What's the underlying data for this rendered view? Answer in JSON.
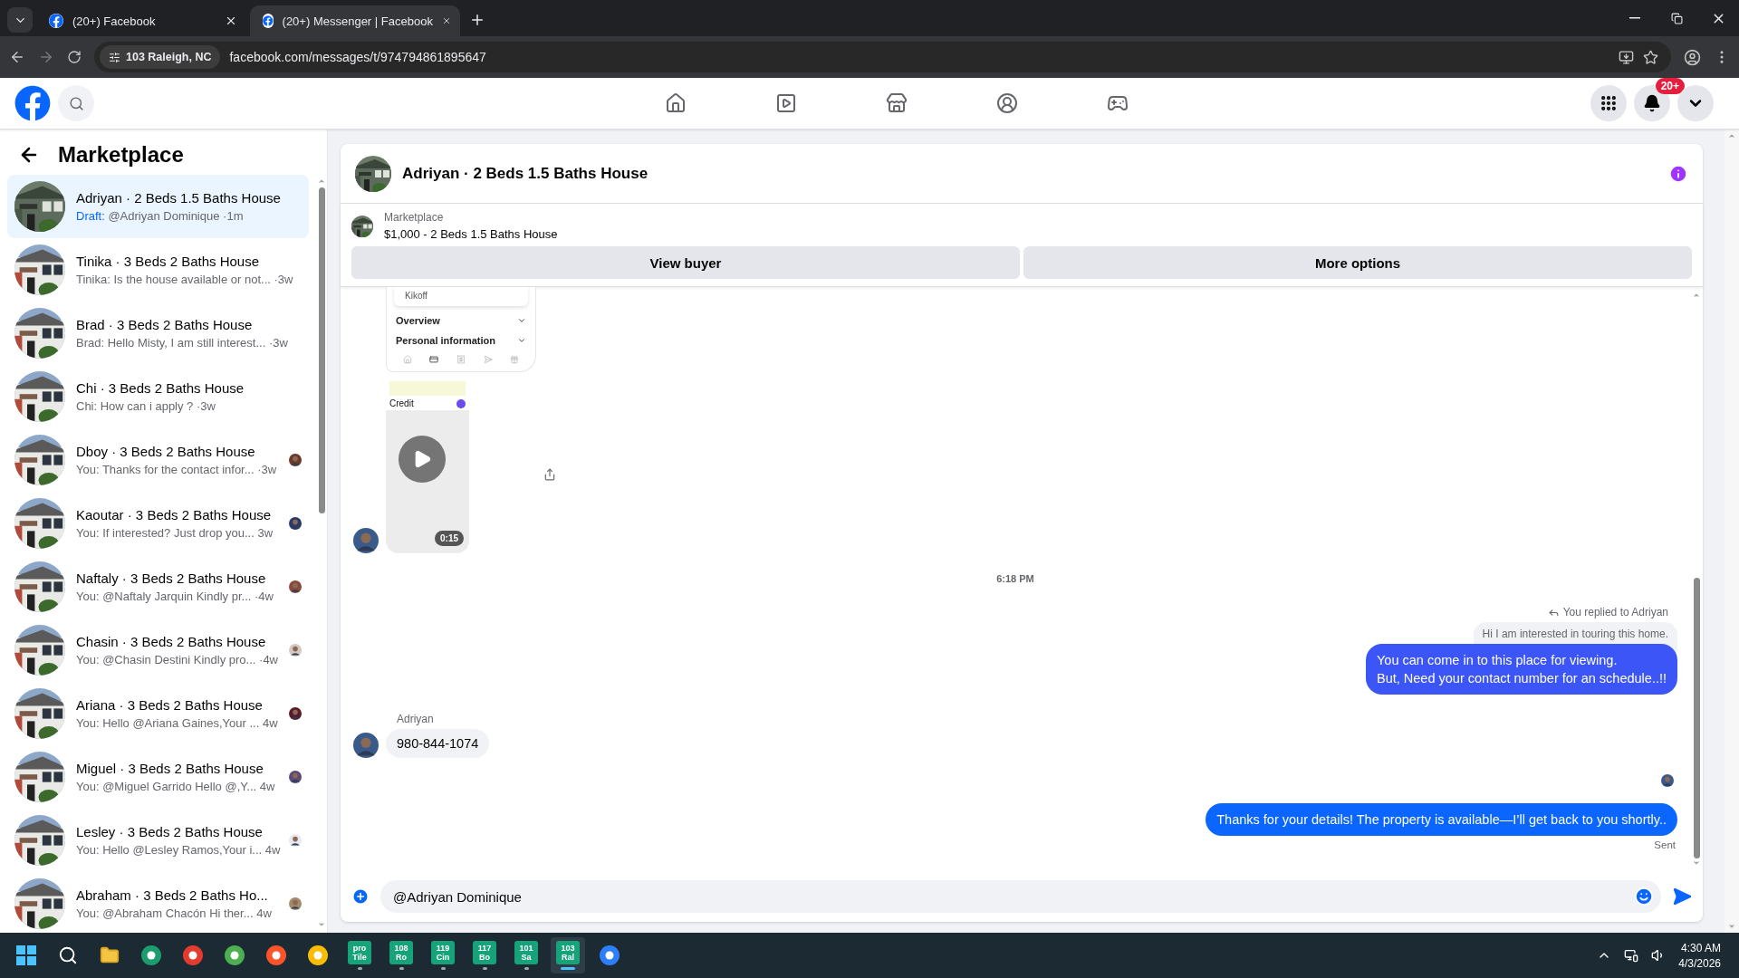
{
  "browser": {
    "tabs": [
      {
        "title": "(20+) Facebook",
        "selected": false
      },
      {
        "title": "(20+) Messenger | Facebook",
        "selected": true
      }
    ],
    "site_chip": "103 Raleigh, NC",
    "url": "facebook.com/messages/t/974794861895647"
  },
  "nav": {
    "notifications_badge": "20+"
  },
  "sidebar": {
    "title": "Marketplace",
    "conversations": [
      {
        "title": "Adriyan · 2 Beds 1.5 Baths House",
        "draft": "Draft:",
        "preview": "@Adriyan Dominique",
        "time": "·1m",
        "selected": true,
        "seen": false
      },
      {
        "title": "Tinika · 3 Beds 2 Baths House",
        "preview": "Tinika: Is the house available or not...",
        "time": "·3w",
        "selected": false,
        "seen": false
      },
      {
        "title": "Brad · 3 Beds 2 Baths House",
        "preview": "Brad: Hello Misty, I am still interest...",
        "time": "·3w",
        "selected": false,
        "seen": false
      },
      {
        "title": "Chi · 3 Beds 2 Baths House",
        "preview": "Chi: How can i apply ?",
        "time": "·3w",
        "selected": false,
        "seen": false
      },
      {
        "title": "Dboy · 3 Beds 2 Baths House",
        "preview": "You: Thanks for the contact infor...",
        "time": "·3w",
        "selected": false,
        "seen": true
      },
      {
        "title": "Kaoutar · 3 Beds 2 Baths House",
        "preview": "You: If interested? Just drop you...",
        "time": "3w",
        "selected": false,
        "seen": true
      },
      {
        "title": "Naftaly · 3 Beds 2 Baths House",
        "preview": "You: @Naftaly Jarquin Kindly pr...",
        "time": "·4w",
        "selected": false,
        "seen": true
      },
      {
        "title": "Chasin · 3 Beds 2 Baths House",
        "preview": "You: @Chasin Destini Kindly pro...",
        "time": "·4w",
        "selected": false,
        "seen": true
      },
      {
        "title": "Ariana · 3 Beds 2 Baths House",
        "preview": "You: Hello @Ariana Gaines,Your ...",
        "time": "4w",
        "selected": false,
        "seen": true
      },
      {
        "title": "Miguel · 3 Beds 2 Baths House",
        "preview": "You: @Miguel Garrido Hello @,Y...",
        "time": "4w",
        "selected": false,
        "seen": true
      },
      {
        "title": "Lesley · 3 Beds 2 Baths House",
        "preview": "You: Hello @Lesley Ramos,Your i...",
        "time": "4w",
        "selected": false,
        "seen": true
      },
      {
        "title": "Abraham · 3 Beds 2 Baths Ho...",
        "preview": "You: @Abraham Chacón Hi ther...",
        "time": "4w",
        "selected": false,
        "seen": true
      }
    ]
  },
  "chat": {
    "title": "Adriyan · 2 Beds 1.5 Baths House",
    "listing": {
      "label": "Marketplace",
      "price_title": "$1,000 - 2 Beds 1.5 Baths House"
    },
    "buttons": [
      "View buyer",
      "More options"
    ],
    "messages": [
      {
        "kind": "media",
        "card_title": "Kikoff",
        "sections": [
          "Overview",
          "Personal information"
        ],
        "screen_title": "Credit",
        "duration": "0:15"
      },
      {
        "kind": "timestamp",
        "text": "6:18 PM"
      },
      {
        "kind": "reply",
        "note": "You replied to Adriyan",
        "quote": "Hi I am interested in touring this home.",
        "lines": [
          "You can come in to this place for viewing.",
          "But, Need your contact number for an schedule..!!"
        ],
        "color": "#3b55f6"
      },
      {
        "kind": "incoming",
        "sender": "Adriyan",
        "text": "980-844-1074"
      },
      {
        "kind": "outgoing",
        "text": "Thanks for your details! The property is available—I’ll get back to you shortly..",
        "color": "#0a66ff",
        "status": "Sent",
        "seen": true
      }
    ],
    "composer": {
      "value": "@Adriyan Dominique"
    }
  },
  "taskbar": {
    "tiles": [
      {
        "label": "pro Tile",
        "selected": false
      },
      {
        "label": "108 Ro",
        "selected": false
      },
      {
        "label": "119 Cin",
        "selected": false
      },
      {
        "label": "117 Bo",
        "selected": false
      },
      {
        "label": "101 Sa",
        "selected": false
      },
      {
        "label": "103 Ral",
        "selected": true
      }
    ],
    "time": "4:30 AM",
    "date": "4/3/2026"
  }
}
